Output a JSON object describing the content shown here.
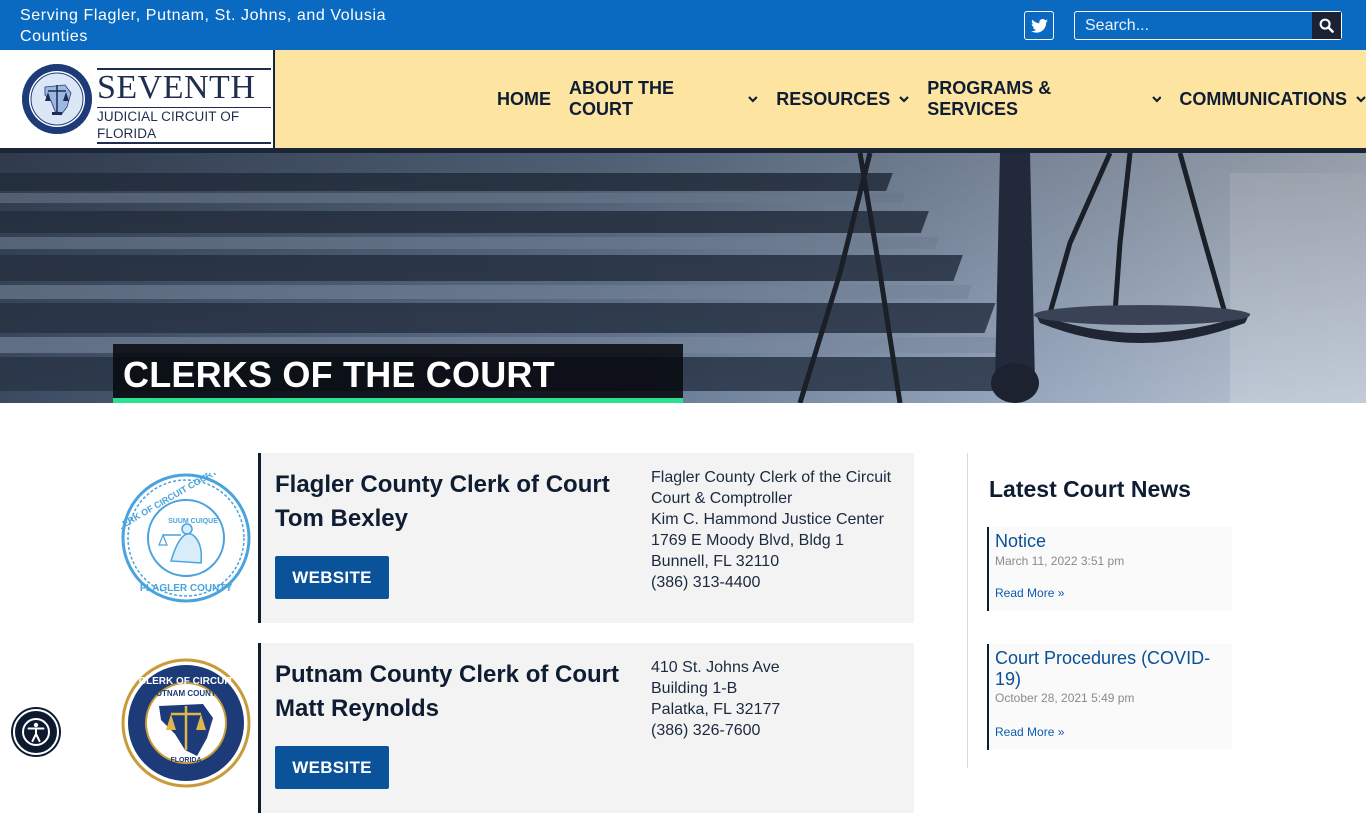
{
  "topbar": {
    "tagline": "Serving Flagler, Putnam, St. Johns, and Volusia Counties",
    "search_placeholder": "Search..."
  },
  "logo": {
    "word_big": "SEVENTH",
    "word_small": "JUDICIAL CIRCUIT OF FLORIDA",
    "seal_top_text": "Seventh Judicial Circuit",
    "seal_bottom_text": "Flagler Putnam St Johns Volusia"
  },
  "nav": {
    "items": [
      {
        "label": "HOME",
        "has_dropdown": false
      },
      {
        "label": "ABOUT THE COURT",
        "has_dropdown": true
      },
      {
        "label": "RESOURCES",
        "has_dropdown": true
      },
      {
        "label": "PROGRAMS & SERVICES",
        "has_dropdown": true
      },
      {
        "label": "COMMUNICATIONS",
        "has_dropdown": true
      }
    ]
  },
  "hero": {
    "title": "CLERKS OF THE COURT",
    "accent": "#2de08e"
  },
  "clerks": [
    {
      "office": "Flagler County Clerk of Court",
      "clerk": "Tom Bexley",
      "button": "WEBSITE",
      "address": [
        "Flagler County Clerk of the Circuit Court & Comptroller",
        "Kim C. Hammond Justice Center",
        "1769 E Moody Blvd, Bldg 1",
        "Bunnell, FL 32110",
        "(386) 313-4400"
      ],
      "seal_text_top": "CLERK OF CIRCUIT COURT & COMPTROLLER",
      "seal_text_bottom": "FLAGLER COUNTY",
      "seal_motto": "SUUM CUIQUE"
    },
    {
      "office": "Putnam County Clerk of Court",
      "clerk": "Matt Reynolds",
      "button": "WEBSITE",
      "address": [
        "410 St. Johns Ave",
        "Building 1-B",
        "Palatka, FL 32177",
        "(386) 326-7600"
      ],
      "seal_text_top": "CLERK OF CIRCUIT COURT & COMPTROLLER",
      "seal_text_inner": "PUTNAM COUNTY",
      "seal_text_bottom": "FLORIDA"
    }
  ],
  "sidebar": {
    "title": "Latest Court News",
    "news": [
      {
        "title": "Notice",
        "date": "March 11, 2022 3:51 pm",
        "read_more": "Read More »"
      },
      {
        "title": "Court Procedures (COVID-19)",
        "date": "October 28, 2021 5:49 pm",
        "read_more": "Read More »"
      }
    ]
  },
  "colors": {
    "topbar": "#0a6ac2",
    "header": "#fde4a0",
    "navy": "#0f1d33",
    "button": "#0a5299"
  },
  "icons": {
    "twitter": "twitter-icon",
    "search": "search-icon",
    "chevron": "chevron-down-icon",
    "accessibility": "accessibility-icon"
  }
}
